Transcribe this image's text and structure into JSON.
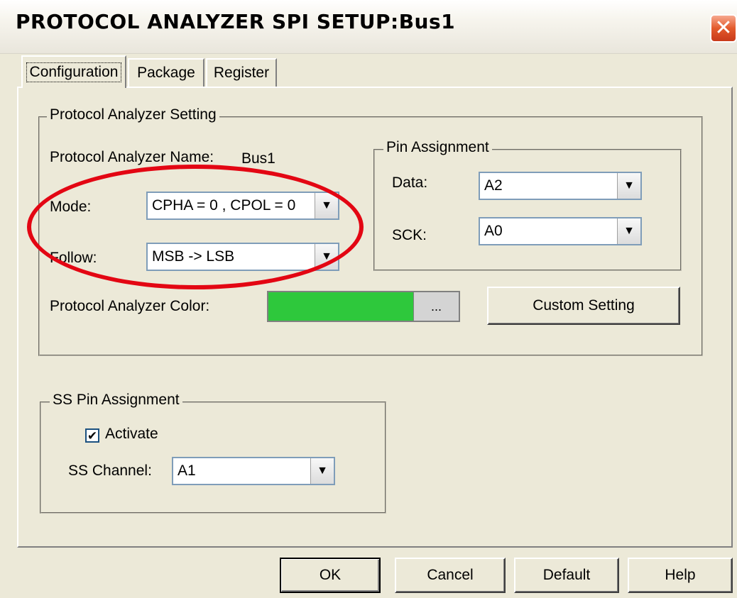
{
  "window": {
    "title": "PROTOCOL ANALYZER SPI SETUP:Bus1",
    "close_symbol": "✕"
  },
  "tabs": [
    {
      "label": "Configuration"
    },
    {
      "label": "Package"
    },
    {
      "label": "Register"
    }
  ],
  "pa_setting": {
    "legend": "Protocol Analyzer Setting",
    "name_label": "Protocol Analyzer Name:",
    "name_value": "Bus1",
    "mode_label": "Mode:",
    "mode_value": "CPHA = 0 , CPOL = 0",
    "follow_label": "Follow:",
    "follow_value": "MSB -> LSB",
    "color_label": "Protocol Analyzer Color:",
    "color_value": "#2ec83c",
    "color_button": "...",
    "custom_button": "Custom Setting"
  },
  "pin_assignment": {
    "legend": "Pin Assignment",
    "data_label": "Data:",
    "data_value": "A2",
    "sck_label": "SCK:",
    "sck_value": "A0"
  },
  "ss_pin": {
    "legend": "SS Pin Assignment",
    "activate_label": "Activate",
    "activate_checked": true,
    "check_mark": "✔",
    "channel_label": "SS Channel:",
    "channel_value": "A1"
  },
  "footer": {
    "ok": "OK",
    "cancel": "Cancel",
    "default": "Default",
    "help": "Help"
  },
  "highlight_color": "#e30613"
}
